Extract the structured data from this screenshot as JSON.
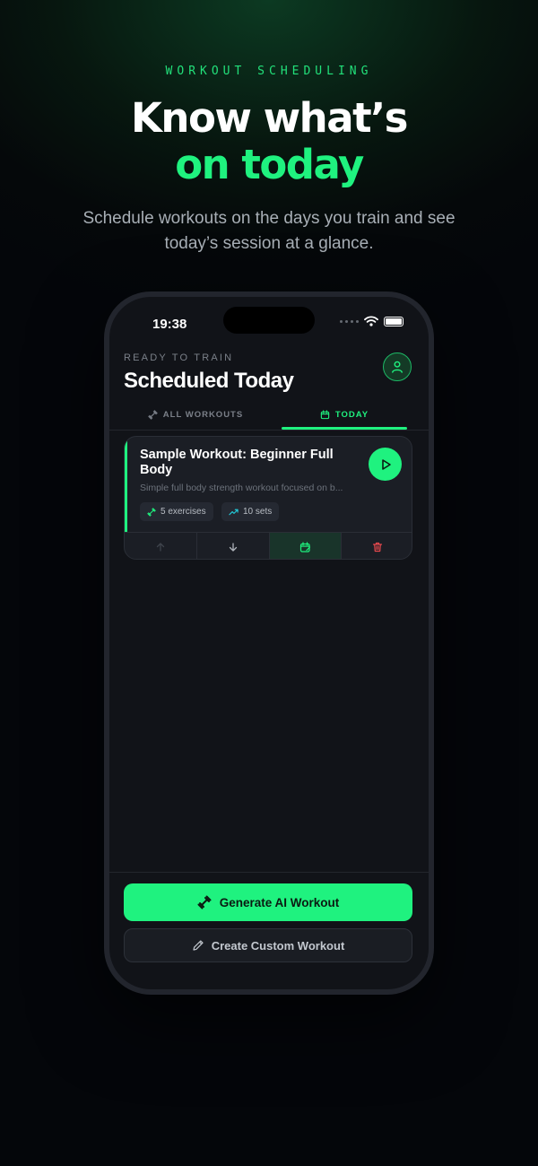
{
  "promo": {
    "eyebrow": "WORKOUT SCHEDULING",
    "headline_line1": "Know what’s",
    "headline_line2": "on today",
    "subhead": "Schedule workouts on the days you train and see today’s session at a glance."
  },
  "status_bar": {
    "time": "19:38",
    "icons": [
      "signal-dots-icon",
      "wifi-icon",
      "battery-icon"
    ]
  },
  "header": {
    "eyebrow": "READY TO TRAIN",
    "title": "Scheduled Today",
    "profile_icon": "user-icon"
  },
  "tabs": [
    {
      "label": "ALL WORKOUTS",
      "icon": "dumbbell-icon",
      "active": false
    },
    {
      "label": "TODAY",
      "icon": "calendar-icon",
      "active": true
    }
  ],
  "workout_card": {
    "title": "Sample Workout: Beginner Full Body",
    "description": "Simple full body strength workout focused on b...",
    "exercises_label": "5 exercises",
    "sets_label": "10 sets",
    "actions": [
      "arrow-up-icon",
      "arrow-down-icon",
      "calendar-edit-icon",
      "trash-icon"
    ]
  },
  "buttons": {
    "generate_label": "Generate AI Workout",
    "create_label": "Create Custom Workout"
  },
  "colors": {
    "accent": "#1ff27f",
    "background": "#05080a",
    "screen": "#111318",
    "card": "#1b1e25",
    "danger": "#e5484d"
  }
}
